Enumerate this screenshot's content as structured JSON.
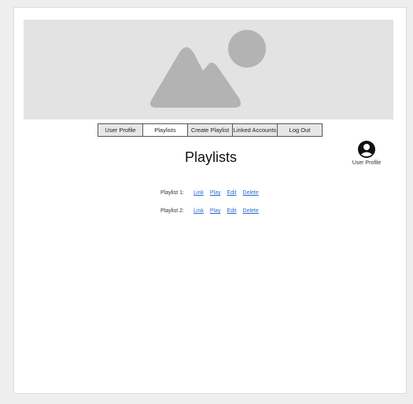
{
  "nav": {
    "tabs": [
      {
        "label": "User Profile",
        "active": false
      },
      {
        "label": "Playlists",
        "active": true
      },
      {
        "label": "Create Playlist",
        "active": false
      },
      {
        "label": "Linked Accounts",
        "active": false
      },
      {
        "label": "Log Out",
        "active": false
      }
    ]
  },
  "profile": {
    "icon": "user-circle-icon",
    "label": "User Profile"
  },
  "hero": {
    "icon": "image-placeholder-icon"
  },
  "main": {
    "title": "Playlists",
    "playlists": [
      {
        "name": "Playlist 1:",
        "actions": [
          "Link",
          "Play",
          "Edit",
          "Delete"
        ]
      },
      {
        "name": "Playlist 2:",
        "actions": [
          "Link",
          "Play",
          "Edit",
          "Delete"
        ]
      }
    ]
  },
  "colors": {
    "page_bg": "#eeeeee",
    "frame_bg": "#ffffff",
    "hero_bg": "#e3e3e3",
    "placeholder_shape": "#b3b3b3",
    "link": "#2a6bd1",
    "tab_inactive_bg": "#e6e6e6",
    "tab_active_bg": "#ffffff"
  }
}
